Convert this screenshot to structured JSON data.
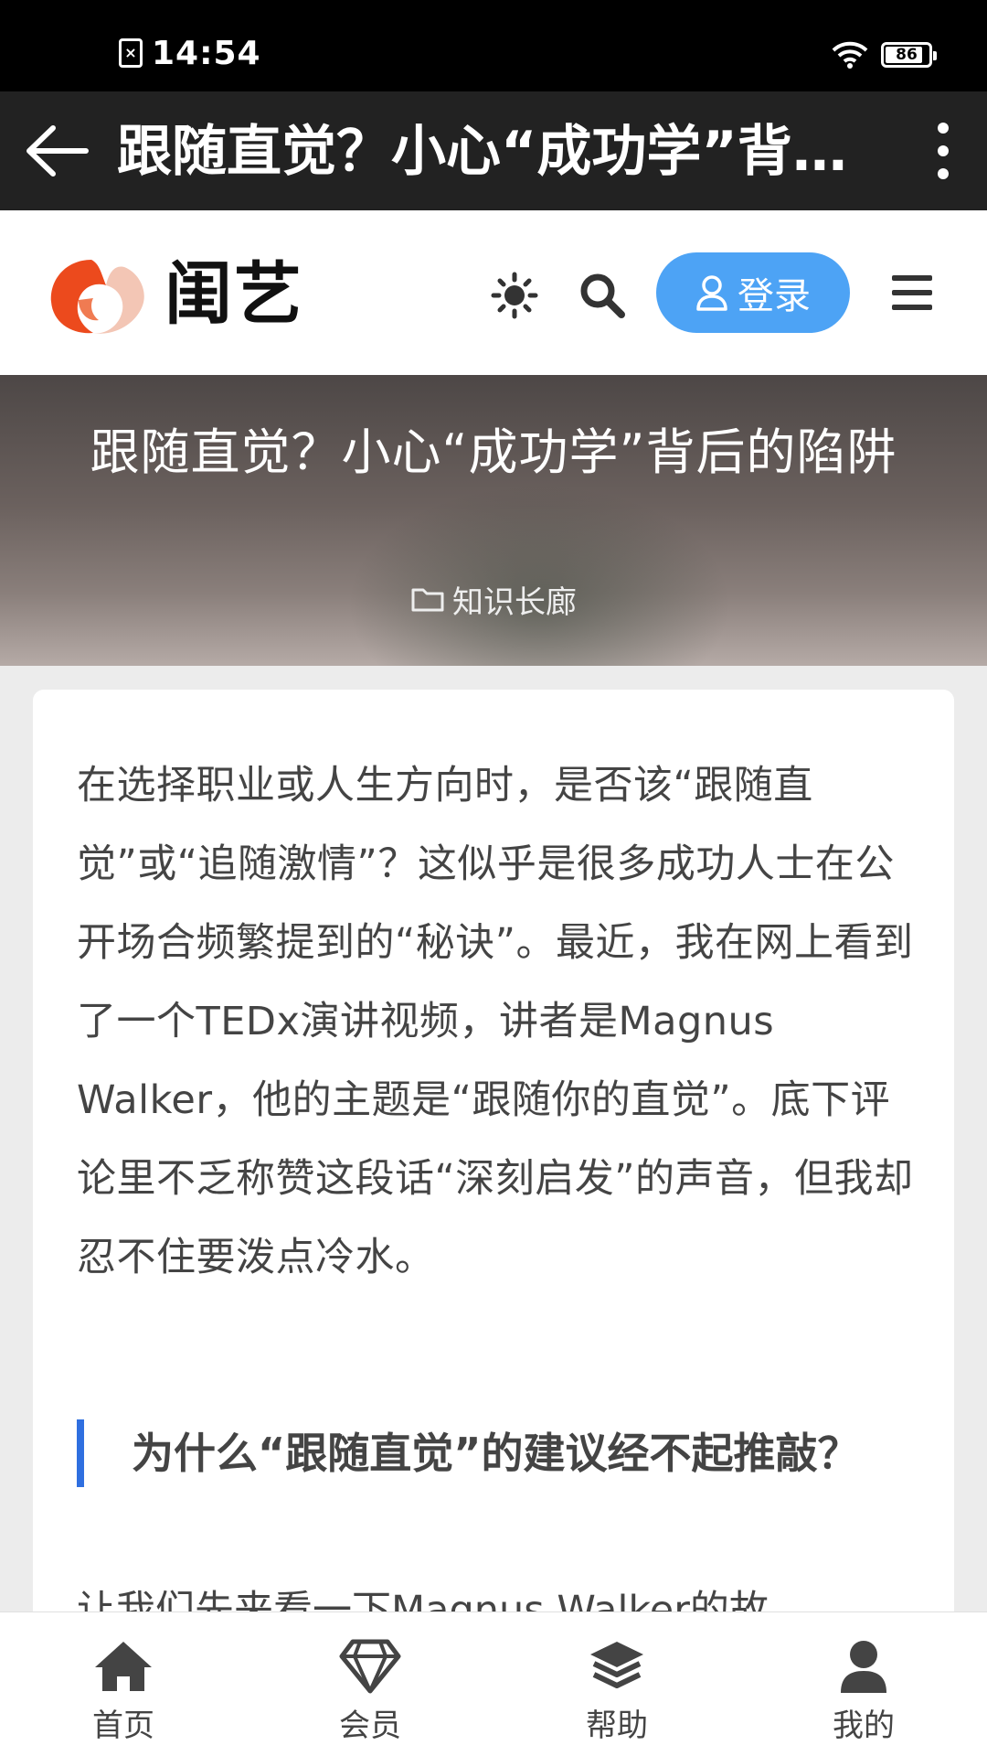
{
  "status_bar": {
    "time": "14:54",
    "battery": "86",
    "sim_icon": "sim-absent-icon"
  },
  "app_bar": {
    "title": "跟随直觉？小心“成功学”背后的陷阱"
  },
  "site": {
    "brand": "闺艺",
    "login_label": "登录"
  },
  "hero": {
    "title": "跟随直觉？小心“成功学”背后的陷阱",
    "category": "知识长廊"
  },
  "article": {
    "intro": "在选择职业或人生方向时，是否该“跟随直觉”或“追随激情”？这似乎是很多成功人士在公开场合频繁提到的“秘诀”。最近，我在网上看到了一个TEDx演讲视频，讲者是Magnus Walker，他的主题是“跟随你的直觉”。底下评论里不乏称赞这段话“深刻启发”的声音，但我却忍不住要泼点冷水。",
    "section_heading": "为什么“跟随直觉”的建议经不起推敲？",
    "next_paragraph": "让我们先来看一下Magnus Walker的故"
  },
  "bottom_nav": [
    {
      "label": "首页",
      "icon": "home-icon"
    },
    {
      "label": "会员",
      "icon": "diamond-icon"
    },
    {
      "label": "帮助",
      "icon": "layers-icon"
    },
    {
      "label": "我的",
      "icon": "user-icon"
    }
  ],
  "colors": {
    "accent": "#4da3f5",
    "heading_bar": "#2f6fe0",
    "app_bar": "#222222"
  }
}
